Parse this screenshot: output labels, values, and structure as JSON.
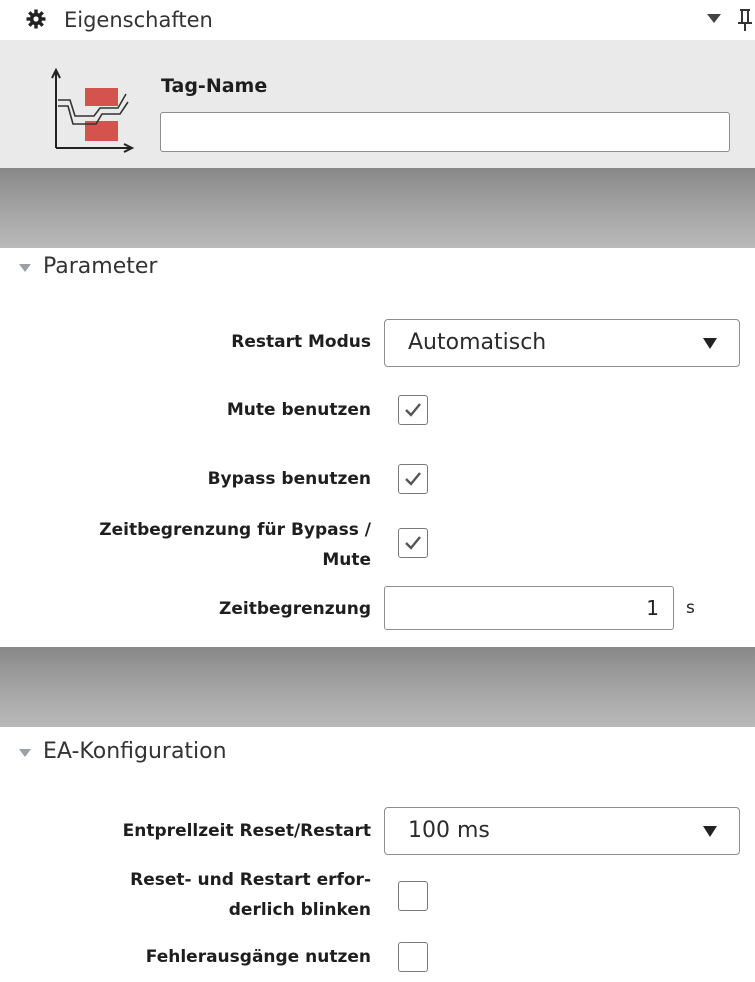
{
  "panel": {
    "title": "Eigenschaften",
    "icons": {
      "title": "gear-icon",
      "menu": "dropdown-arrow-icon",
      "pin": "pin-icon",
      "tag": "tag-signal-icon"
    }
  },
  "tag": {
    "label": "Tag-Name",
    "value": ""
  },
  "sections": {
    "parameter": {
      "title": "Parameter",
      "restart_mode_label": "Restart Modus",
      "restart_mode_value": "Automatisch",
      "mute_label": "Mute benutzen",
      "mute_checked": true,
      "bypass_label": "Bypass benutzen",
      "bypass_checked": true,
      "time_limit_bypass_label_line1": "Zeitbegrenzung für Bypass /",
      "time_limit_bypass_label_line2": "Mute",
      "time_limit_bypass_checked": true,
      "time_limit_label": "Zeitbegrenzung",
      "time_limit_value": "1",
      "time_limit_unit": "s"
    },
    "io_config": {
      "title": "EA-Konfiguration",
      "debounce_label": "Entprellzeit Reset/Restart",
      "debounce_value": "100 ms",
      "reset_blink_label_line1": "Reset- und Restart erfor-",
      "reset_blink_label_line2": "derlich blinken",
      "reset_blink_checked": false,
      "error_outputs_label": "Fehlerausgänge nutzen",
      "error_outputs_checked": false
    }
  },
  "colors": {
    "accent_red": "#d4534f",
    "check": "#555555",
    "band_gray": "#9c9c9c",
    "header_bg": "#eaeaea"
  }
}
